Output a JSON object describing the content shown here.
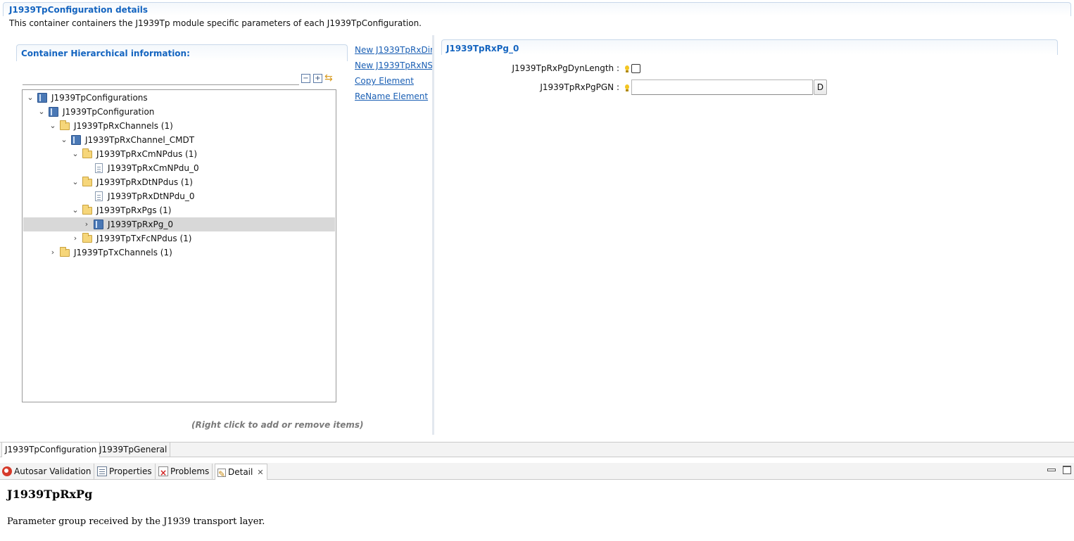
{
  "header": {
    "title": "J1939TpConfiguration details",
    "description": "This container containers the J1939Tp module specific parameters of each J1939TpConfiguration."
  },
  "hierarchy": {
    "title": "Container Hierarchical information:",
    "filter_value": "",
    "toolbar": {
      "collapse_icon": "collapse-all-icon",
      "expand_icon": "expand-all-icon",
      "sync_icon": "link-sync-icon"
    },
    "tree": [
      {
        "label": "J1939TpConfigurations",
        "icon": "module-book-icon",
        "state": "expanded",
        "depth": 0
      },
      {
        "label": "J1939TpConfiguration",
        "icon": "module-book-icon",
        "state": "expanded",
        "depth": 1
      },
      {
        "label": "J1939TpRxChannels (1)",
        "icon": "folder-icon",
        "state": "expanded",
        "depth": 2
      },
      {
        "label": "J1939TpRxChannel_CMDT",
        "icon": "module-book-icon",
        "state": "expanded",
        "depth": 3
      },
      {
        "label": "J1939TpRxCmNPdus (1)",
        "icon": "folder-icon",
        "state": "expanded",
        "depth": 4
      },
      {
        "label": "J1939TpRxCmNPdu_0",
        "icon": "file-icon",
        "state": "leaf",
        "depth": 5
      },
      {
        "label": "J1939TpRxDtNPdus (1)",
        "icon": "folder-icon",
        "state": "expanded",
        "depth": 4
      },
      {
        "label": "J1939TpRxDtNPdu_0",
        "icon": "file-icon",
        "state": "leaf",
        "depth": 5
      },
      {
        "label": "J1939TpRxPgs (1)",
        "icon": "folder-icon",
        "state": "expanded",
        "depth": 4
      },
      {
        "label": "J1939TpRxPg_0",
        "icon": "module-book-icon",
        "state": "collapsed",
        "depth": 5,
        "selected": true
      },
      {
        "label": "J1939TpTxFcNPdus (1)",
        "icon": "folder-icon",
        "state": "collapsed",
        "depth": 4
      },
      {
        "label": "J1939TpTxChannels (1)",
        "icon": "folder-icon",
        "state": "collapsed",
        "depth": 2
      }
    ],
    "hint": "(Right click to add or remove items)"
  },
  "actions": [
    "New J1939TpRxDir",
    "New J1939TpRxNS",
    "Copy Element",
    "ReName Element"
  ],
  "detail": {
    "title": "J1939TpRxPg_0",
    "params": {
      "dyn_length_label": "J1939TpRxPgDynLength :",
      "dyn_length_checked": false,
      "pgn_label": "J1939TpRxPgPGN :",
      "pgn_value": "",
      "pgn_button": "D"
    }
  },
  "page_tabs": [
    {
      "label": "J1939TpConfiguration",
      "active": true
    },
    {
      "label": "J1939TpGeneral",
      "active": false
    }
  ],
  "views": [
    {
      "label": "Autosar Validation",
      "icon": "validation-icon"
    },
    {
      "label": "Properties",
      "icon": "properties-icon"
    },
    {
      "label": "Problems",
      "icon": "problems-icon"
    },
    {
      "label": "Detail",
      "icon": "detail-icon",
      "active": true
    }
  ],
  "doc": {
    "title": "J1939TpRxPg",
    "description": "Parameter group received by the J1939 transport layer."
  },
  "colors": {
    "accent": "#1565c0",
    "link": "#1a5fb4",
    "selection": "#d8d8d8"
  }
}
